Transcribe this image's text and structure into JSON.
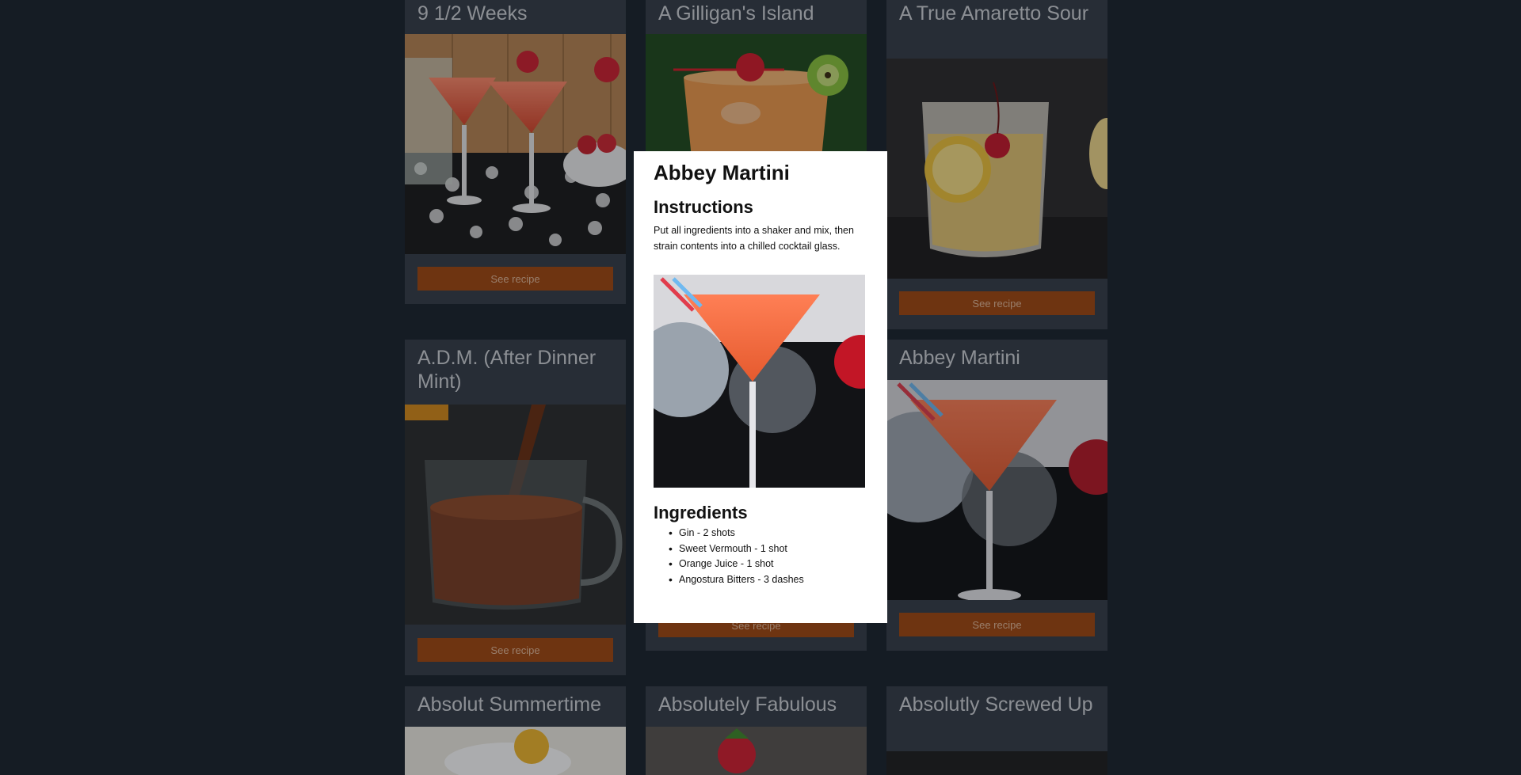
{
  "cards": [
    {
      "title": "9 1/2 Weeks",
      "button": "See recipe"
    },
    {
      "title": "A Gilligan's Island",
      "button": "See recipe"
    },
    {
      "title": "A True Amaretto Sour",
      "button": "See recipe"
    },
    {
      "title": "A.D.M. (After Dinner Mint)",
      "button": "See recipe"
    },
    {
      "title": "Abbey Martini",
      "button": "See recipe"
    },
    {
      "title": "Absolut Summertime"
    },
    {
      "title": "Absolutely Fabulous"
    },
    {
      "title": "Absolutly Screwed Up"
    }
  ],
  "hidden_card": {
    "button": "See recipe"
  },
  "modal": {
    "title": "Abbey Martini",
    "instructions_heading": "Instructions",
    "instructions": "Put all ingredients into a shaker and mix, then strain contents into a chilled cocktail glass.",
    "ingredients_heading": "Ingredients",
    "ingredients": [
      "Gin - 2 shots",
      "Sweet Vermouth - 1 shot",
      "Orange Juice - 1 shot",
      "Angostura Bitters - 3 dashes"
    ]
  }
}
